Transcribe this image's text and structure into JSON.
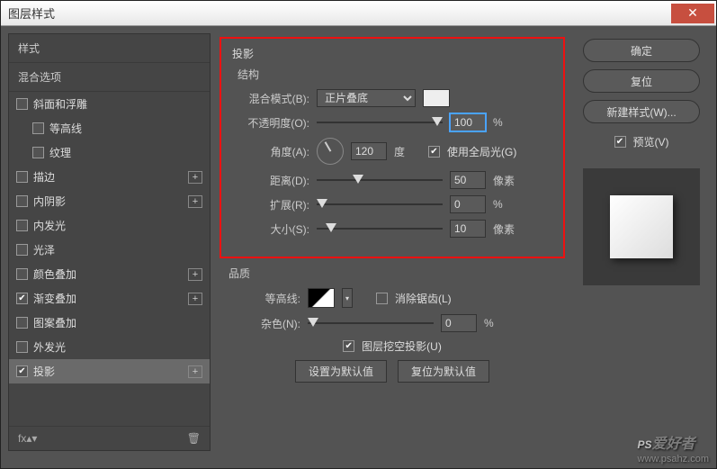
{
  "title": "图层样式",
  "left": {
    "header_style": "样式",
    "header_blend": "混合选项",
    "items": [
      {
        "label": "斜面和浮雕",
        "checked": false,
        "plus": false,
        "indent": false
      },
      {
        "label": "等高线",
        "checked": false,
        "plus": false,
        "indent": true
      },
      {
        "label": "纹理",
        "checked": false,
        "plus": false,
        "indent": true
      },
      {
        "label": "描边",
        "checked": false,
        "plus": true,
        "indent": false
      },
      {
        "label": "内阴影",
        "checked": false,
        "plus": true,
        "indent": false
      },
      {
        "label": "内发光",
        "checked": false,
        "plus": false,
        "indent": false
      },
      {
        "label": "光泽",
        "checked": false,
        "plus": false,
        "indent": false
      },
      {
        "label": "颜色叠加",
        "checked": false,
        "plus": true,
        "indent": false
      },
      {
        "label": "渐变叠加",
        "checked": true,
        "plus": true,
        "indent": false
      },
      {
        "label": "图案叠加",
        "checked": false,
        "plus": false,
        "indent": false
      },
      {
        "label": "外发光",
        "checked": false,
        "plus": false,
        "indent": false
      },
      {
        "label": "投影",
        "checked": true,
        "plus": true,
        "indent": false,
        "selected": true
      }
    ],
    "foot_fx": "fx"
  },
  "mid": {
    "section": "投影",
    "structure": "结构",
    "blend_mode_label": "混合模式(B):",
    "blend_mode_value": "正片叠底",
    "opacity_label": "不透明度(O):",
    "opacity_value": "100",
    "opacity_unit": "%",
    "angle_label": "角度(A):",
    "angle_value": "120",
    "angle_unit": "度",
    "global_light": "使用全局光(G)",
    "distance_label": "距离(D):",
    "distance_value": "50",
    "distance_unit": "像素",
    "spread_label": "扩展(R):",
    "spread_value": "0",
    "spread_unit": "%",
    "size_label": "大小(S):",
    "size_value": "10",
    "size_unit": "像素",
    "quality": "品质",
    "contour_label": "等高线:",
    "antialias": "消除锯齿(L)",
    "noise_label": "杂色(N):",
    "noise_value": "0",
    "noise_unit": "%",
    "knockout": "图层挖空投影(U)",
    "set_default": "设置为默认值",
    "reset_default": "复位为默认值"
  },
  "right": {
    "ok": "确定",
    "cancel": "复位",
    "new_style": "新建样式(W)...",
    "preview": "预览(V)"
  },
  "watermark": {
    "brand": "PS",
    "sub": "爱好者",
    "url": "www.psahz.com"
  }
}
